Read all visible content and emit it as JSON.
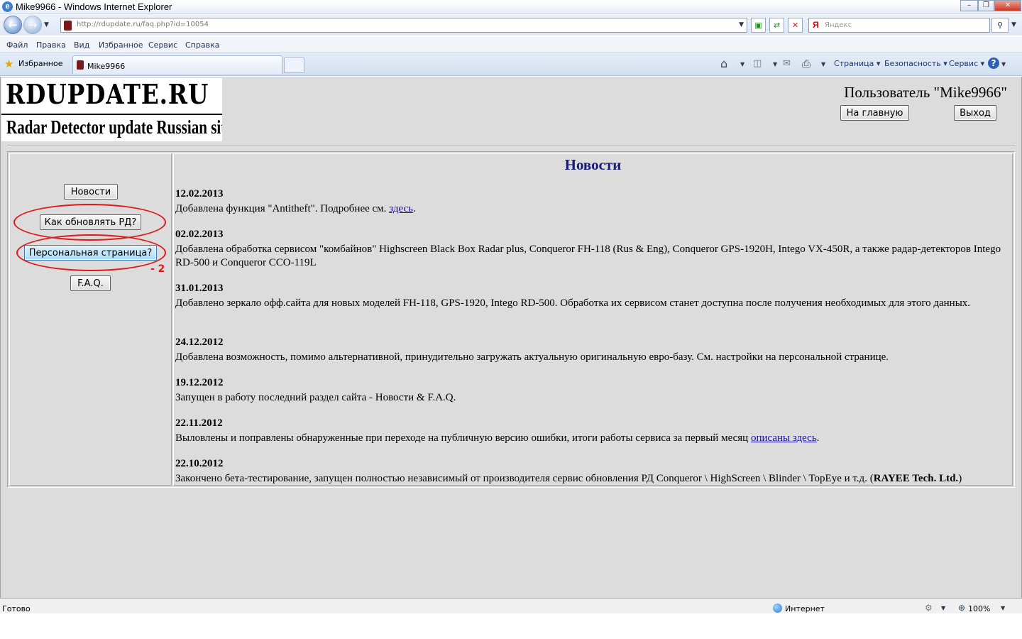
{
  "window": {
    "title": "Mike9966 - Windows Internet Explorer"
  },
  "address": {
    "url_host": "http://rdupdate.ru",
    "url_path": "/faq.php?id=10054",
    "search_placeholder": "Яндекс",
    "search_brand": "Я"
  },
  "menu": {
    "items": [
      "Файл",
      "Правка",
      "Вид",
      "Избранное",
      "Сервис",
      "Справка"
    ]
  },
  "tabbar": {
    "favorites": "Избранное",
    "tab_title": "Mike9966",
    "page_menu": "Страница",
    "safety_menu": "Безопасность",
    "service_menu": "Сервис"
  },
  "header": {
    "logo_line1": "RDUPDATE.RU",
    "logo_line2": "Radar Detector update Russian site",
    "user": "Пользователь \"Mike9966\"",
    "home_button": "На главную",
    "logout_button": "Выход"
  },
  "sidebar": {
    "news": "Новости",
    "how_update": "Как обновлять РД?",
    "personal": "Персональная страница?",
    "faq": "F.A.Q.",
    "annotation": "- 2"
  },
  "news": {
    "title": "Новости",
    "items": [
      {
        "date": "12.02.2013",
        "text": "Добавлена функция \"Antitheft\". Подробнее см. ",
        "link": "здесь",
        "after": "."
      },
      {
        "date": "02.02.2013",
        "text": "Добавлена обработка сервисом \"комбайнов\" Highscreen Black Box Radar plus, Conqueror FH-118 (Rus & Eng), Conqueror GPS-1920H, Intego VX-450R, а также радар-детекторов Intego RD-500 и Conqueror CCO-119L"
      },
      {
        "date": "31.01.2013",
        "text": "Добавлено зеркало офф.сайта для новых моделей FH-118, GPS-1920, Intego RD-500. Обработка их сервисом станет доступна после получения необходимых для этого данных."
      },
      {
        "date": "24.12.2012",
        "text": "Добавлена возможность, помимо альтернативной, принудительно загружать актуальную оригинальную евро-базу. См. настройки на персональной странице."
      },
      {
        "date": "19.12.2012",
        "text": "Запущен в работу последний раздел сайта - Новости & F.A.Q."
      },
      {
        "date": "22.11.2012",
        "text": "Выловлены и поправлены обнаруженные при переходе на публичную версию ошибки, итоги работы сервиса за первый месяц ",
        "link": "описаны здесь",
        "after": "."
      },
      {
        "date": "22.10.2012",
        "text": "Закончено бета-тестирование, запущен полностью независимый от производителя сервис обновления РД Conqueror \\ HighScreen \\ Blinder \\ TopEye и т.д.  (",
        "bold": "RAYEE Tech. Ltd.",
        "after": ")"
      }
    ]
  },
  "status": {
    "text": "Готово",
    "zone": "Интернет",
    "zoom": "100%"
  }
}
